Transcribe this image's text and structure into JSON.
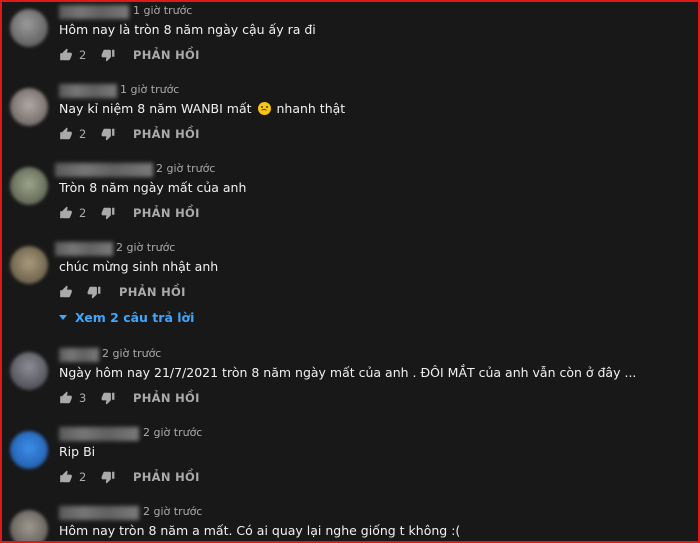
{
  "comments": [
    {
      "time": "1 giờ trước",
      "text": "Hôm nay là tròn 8 năm ngày cậu ấy ra đi",
      "likes": "2",
      "reply": "PHẢN HỒI"
    },
    {
      "time": "1 giờ trước",
      "text_before": "Nay kỉ niệm 8 năm WANBI mất",
      "text_after": "nhanh thật",
      "likes": "2",
      "reply": "PHẢN HỒI"
    },
    {
      "time": "2 giờ trước",
      "text": "Tròn 8 năm ngày mất của anh",
      "likes": "2",
      "reply": "PHẢN HỒI"
    },
    {
      "time": "2 giờ trước",
      "text": "chúc mừng sinh nhật anh",
      "likes": "",
      "reply": "PHẢN HỒI"
    },
    {
      "time": "2 giờ trước",
      "text": "Ngày hôm nay 21/7/2021 tròn 8 năm ngày mất của anh . ĐÔI MẮT của anh vẫn còn ở đây ...",
      "likes": "3",
      "reply": "PHẢN HỒI"
    },
    {
      "time": "2 giờ trước",
      "text": "Rip Bi",
      "likes": "2",
      "reply": "PHẢN HỒI"
    },
    {
      "time": "2 giờ trước",
      "text": "Hôm nay tròn 8 năm a mất. Có ai quay lại nghe giống t không :("
    }
  ],
  "view_replies": "Xem 2 câu trả lời",
  "icons": {
    "like": "thumbs-up-icon",
    "dislike": "thumbs-down-icon",
    "emoji": "sad-face-emoji",
    "expand": "caret-down-icon"
  },
  "colors": {
    "background": "#181818",
    "text": "#f1f1f1",
    "secondary": "#aaaaaa",
    "link": "#3ea6ff",
    "border": "#e01818"
  }
}
